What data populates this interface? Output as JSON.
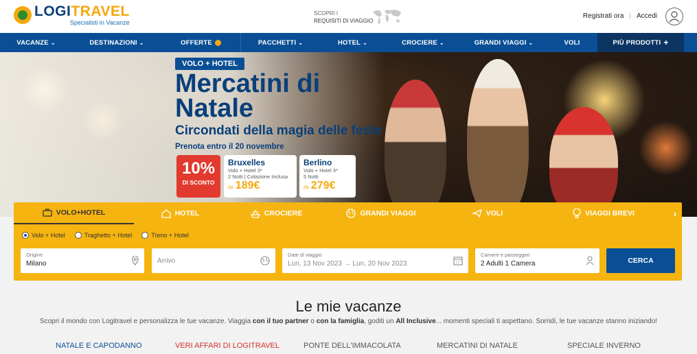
{
  "header": {
    "logo_name_a": "LOGI",
    "logo_name_b": "TRAVEL",
    "logo_tagline": "Specialisti in Vacanze",
    "requirements_line1": "SCOPRI I",
    "requirements_line2": "REQUISITI DI VIAGGIO",
    "register": "Registrati ora",
    "separator": "|",
    "login": "Accedi"
  },
  "nav": {
    "items": [
      {
        "label": "VACANZE",
        "chevron": "⌄"
      },
      {
        "label": "DESTINAZIONI",
        "chevron": "⌄"
      },
      {
        "label": "OFFERTE",
        "chevron": ""
      },
      {
        "label": "PACCHETTI",
        "chevron": "⌄"
      },
      {
        "label": "HOTEL",
        "chevron": "⌄"
      },
      {
        "label": "CROCIERE",
        "chevron": "⌄"
      },
      {
        "label": "GRANDI VIAGGI",
        "chevron": "⌄"
      },
      {
        "label": "VOLI",
        "chevron": ""
      }
    ],
    "more": "PIÙ PRODOTTI",
    "more_icon": "+"
  },
  "hero": {
    "tag": "VOLO + HOTEL",
    "title": "Mercatini di Natale",
    "subtitle": "Circondati della magia delle feste",
    "note": "Prenota entro il 20 novembre",
    "discount_pct": "10%",
    "discount_label": "DI SCONTO",
    "offers": [
      {
        "city": "Bruxelles",
        "line1": "Volo + Hotel 3*",
        "line2": "2 Notti | Colazione Inclusa",
        "from": "da",
        "price": "189€"
      },
      {
        "city": "Berlino",
        "line1": "Volo + Hotel 3*",
        "line2": "5 Notti",
        "from": "da",
        "price": "279€"
      }
    ]
  },
  "search": {
    "tabs": [
      {
        "label": "VOLO+HOTEL",
        "icon": "suitcase-icon",
        "active": true
      },
      {
        "label": "HOTEL",
        "icon": "house-icon",
        "active": false
      },
      {
        "label": "CROCIERE",
        "icon": "ship-icon",
        "active": false
      },
      {
        "label": "GRANDI VIAGGI",
        "icon": "globe-icon",
        "active": false
      },
      {
        "label": "VOLI",
        "icon": "plane-icon",
        "active": false
      },
      {
        "label": "VIAGGI BREVI",
        "icon": "balloon-icon",
        "active": false
      }
    ],
    "next_arrow": "›",
    "radios": [
      {
        "label": "Volo + Hotel",
        "checked": true
      },
      {
        "label": "Traghetto + Hotel",
        "checked": false
      },
      {
        "label": "Treno + Hotel",
        "checked": false
      }
    ],
    "origin_label": "Origine",
    "origin_value": "Milano",
    "arrival_placeholder": "Arrivo",
    "dates_label": "Date di viaggio",
    "dates_value": "Lun, 13 Nov 2023 → Lun, 20 Nov 2023",
    "rooms_label": "Camere e passeggeri",
    "rooms_value": "2 Adulti 1 Camera",
    "submit": "CERCA"
  },
  "vacations": {
    "title": "Le mie vacanze",
    "desc_1": "Scopri il mondo con Logitravel e personalizza le tue vacanze. Viaggia ",
    "desc_b1": "con il tuo partner",
    "desc_2": " o ",
    "desc_b2": "con la famiglia",
    "desc_3": ", goditi un ",
    "desc_b3": "All Inclusive",
    "desc_4": "... momenti speciali ti aspettano. Sorridi, le tue vacanze stanno iniziando!",
    "categories": [
      "NATALE E CAPODANNO",
      "VERI AFFARI DI LOGITRAVEL",
      "PONTE DELL'IMMACOLATA",
      "MERCATINI DI NATALE",
      "SPECIALE INVERNO"
    ]
  },
  "colors": {
    "brand_blue": "#0a4f95",
    "brand_yellow": "#f6b410",
    "discount_red": "#e23a2e"
  }
}
